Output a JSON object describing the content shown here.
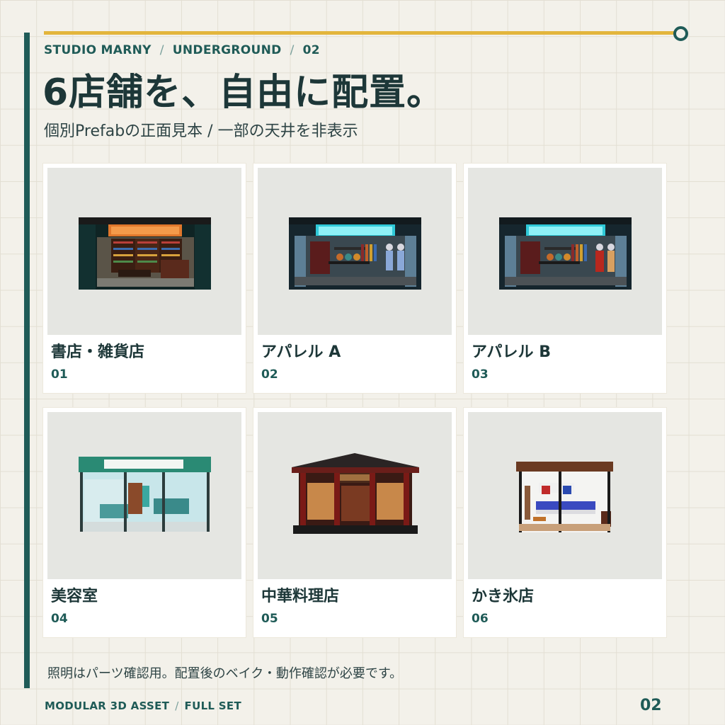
{
  "header": {
    "breadcrumb": [
      "STUDIO MARNY",
      "UNDERGROUND",
      "02"
    ],
    "breadcrumb_separator": "/",
    "title": "6店舗を、自由に配置。",
    "subtitle": "個別Prefabの正面見本 / 一部の天井を非表示"
  },
  "stores": [
    {
      "name": "書店・雑貨店",
      "number": "01"
    },
    {
      "name": "アパレル A",
      "number": "02"
    },
    {
      "name": "アパレル B",
      "number": "03"
    },
    {
      "name": "美容室",
      "number": "04"
    },
    {
      "name": "中華料理店",
      "number": "05"
    },
    {
      "name": "かき氷店",
      "number": "06"
    }
  ],
  "note": "照明はパーツ確認用。配置後のベイク・動作確認が必要です。",
  "footer": {
    "left": [
      "MODULAR 3D ASSET",
      "FULL SET"
    ],
    "separator": "/",
    "page_number": "02"
  },
  "colors": {
    "background": "#f3f1ea",
    "accent_teal": "#1f5b57",
    "accent_yellow": "#e3b53c",
    "text_dark": "#1d3738"
  }
}
